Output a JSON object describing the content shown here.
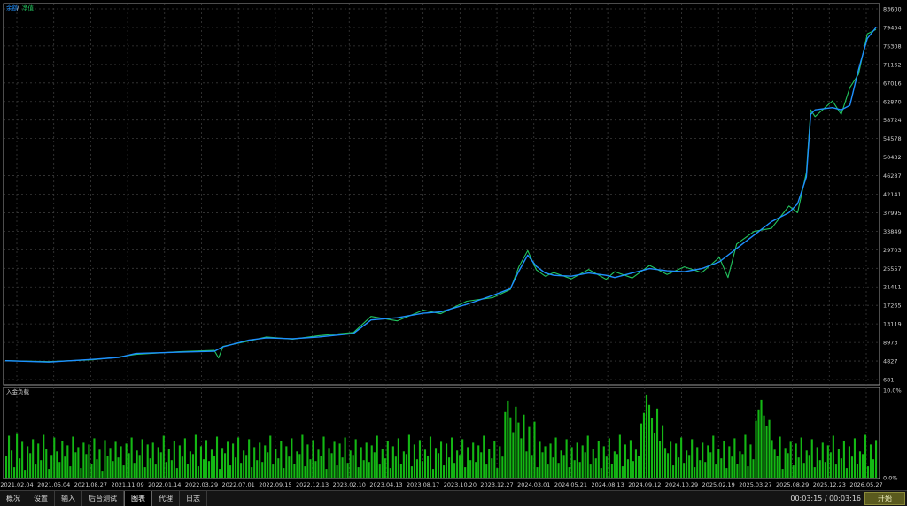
{
  "legend": {
    "balance_label": "余额",
    "separator": "/",
    "equity_label": "净值",
    "balance_color": "#1e90ff",
    "equity_color": "#22c55e"
  },
  "deposit_label": "入金负载",
  "tabs": [
    {
      "label": "概况",
      "active": false
    },
    {
      "label": "设置",
      "active": false
    },
    {
      "label": "输入",
      "active": false
    },
    {
      "label": "后台测试",
      "active": false
    },
    {
      "label": "图表",
      "active": true
    },
    {
      "label": "代理",
      "active": false
    },
    {
      "label": "日志",
      "active": false
    }
  ],
  "timer": "00:03:15 / 00:03:16",
  "start_label": "开始",
  "chart_data": [
    {
      "type": "line",
      "y_ticks": [
        "83600",
        "79454",
        "75308",
        "71162",
        "67016",
        "62870",
        "58724",
        "54578",
        "50432",
        "46287",
        "42141",
        "37995",
        "33849",
        "29703",
        "25557",
        "21411",
        "17265",
        "13119",
        "8973",
        "4827",
        "681"
      ],
      "ylim": [
        681,
        83600
      ],
      "x_ticks": [
        "2021.02.04",
        "2021.05.04",
        "2021.08.27",
        "2021.11.09",
        "2022.01.14",
        "2022.03.29",
        "2022.07.01",
        "2022.09.15",
        "2022.12.13",
        "2023.02.10",
        "2023.04.13",
        "2023.08.17",
        "2023.10.20",
        "2023.12.27",
        "2024.03.01",
        "2024.05.21",
        "2024.08.13",
        "2024.09.12",
        "2024.10.29",
        "2025.02.19",
        "2025.03.27",
        "2025.08.29",
        "2025.12.23",
        "2026.05.27"
      ],
      "grid": true,
      "series": [
        {
          "name": "余额",
          "color": "#1e90ff",
          "x": [
            0,
            0.05,
            0.1,
            0.13,
            0.15,
            0.2,
            0.24,
            0.25,
            0.28,
            0.3,
            0.33,
            0.36,
            0.4,
            0.42,
            0.45,
            0.48,
            0.5,
            0.53,
            0.56,
            0.58,
            0.59,
            0.6,
            0.61,
            0.62,
            0.63,
            0.65,
            0.67,
            0.69,
            0.7,
            0.72,
            0.74,
            0.76,
            0.78,
            0.8,
            0.82,
            0.84,
            0.86,
            0.88,
            0.9,
            0.91,
            0.92,
            0.925,
            0.93,
            0.95,
            0.96,
            0.97,
            0.98,
            0.99,
            1.0
          ],
          "values": [
            4900,
            4600,
            5200,
            5600,
            6500,
            6800,
            7000,
            8000,
            9500,
            10000,
            9800,
            10200,
            11000,
            14000,
            14500,
            15500,
            15800,
            17500,
            19500,
            21000,
            25000,
            28500,
            26000,
            24500,
            24000,
            23800,
            24500,
            24000,
            23500,
            24500,
            25500,
            25000,
            24800,
            25500,
            27000,
            30000,
            33000,
            36000,
            38000,
            40000,
            46000,
            60000,
            61000,
            61500,
            61000,
            62000,
            70000,
            77000,
            79454
          ]
        },
        {
          "name": "净值",
          "color": "#22c55e",
          "x": [
            0,
            0.05,
            0.1,
            0.13,
            0.15,
            0.2,
            0.24,
            0.245,
            0.25,
            0.28,
            0.3,
            0.33,
            0.36,
            0.4,
            0.42,
            0.45,
            0.48,
            0.5,
            0.53,
            0.56,
            0.58,
            0.59,
            0.6,
            0.61,
            0.62,
            0.63,
            0.65,
            0.67,
            0.69,
            0.7,
            0.72,
            0.74,
            0.76,
            0.78,
            0.8,
            0.82,
            0.83,
            0.84,
            0.86,
            0.88,
            0.9,
            0.91,
            0.92,
            0.925,
            0.93,
            0.95,
            0.96,
            0.97,
            0.98,
            0.99,
            1.0
          ],
          "values": [
            4900,
            4700,
            5100,
            5700,
            6300,
            6900,
            7200,
            5500,
            8100,
            9300,
            10200,
            9700,
            10500,
            11200,
            14800,
            13800,
            16200,
            15400,
            18200,
            19000,
            20800,
            26000,
            29500,
            25200,
            23800,
            24600,
            23200,
            25300,
            23100,
            24800,
            23400,
            26200,
            24200,
            25900,
            24600,
            28000,
            23500,
            31000,
            33800,
            34500,
            39500,
            38000,
            47000,
            61000,
            59500,
            63000,
            60000,
            66000,
            69000,
            78000,
            79000
          ]
        }
      ]
    },
    {
      "type": "bar",
      "title": "入金负载",
      "y_ticks": [
        "10.0%",
        "0.0%"
      ],
      "ylim": [
        0,
        10
      ],
      "grid": true,
      "values": [
        2.5,
        4.8,
        3.1,
        1.2,
        5.0,
        2.2,
        4.1,
        0.9,
        3.6,
        2.8,
        4.4,
        1.5,
        3.9,
        2.0,
        4.9,
        3.3,
        1.0,
        2.6,
        4.6,
        3.0,
        1.8,
        4.2,
        2.4,
        3.7,
        1.3,
        4.7,
        2.9,
        3.5,
        1.1,
        4.0,
        2.7,
        3.8,
        1.6,
        4.5,
        2.1,
        3.2,
        0.8,
        4.3,
        2.5,
        3.4,
        1.9,
        4.1,
        2.3,
        3.6,
        1.4,
        3.9,
        2.8,
        4.6,
        1.7,
        3.1,
        2.6,
        4.4,
        1.2,
        3.8,
        2.2,
        4.0,
        1.5,
        3.5,
        2.9,
        4.8,
        1.8,
        3.3,
        2.0,
        4.2,
        1.1,
        3.7,
        2.4,
        4.5,
        1.6,
        3.0,
        2.7,
        4.9,
        1.3,
        3.6,
        2.1,
        4.3,
        1.9,
        3.2,
        2.5,
        4.7,
        1.0,
        3.4,
        2.8,
        4.1,
        1.4,
        3.9,
        2.3,
        4.6,
        1.7,
        3.1,
        2.6,
        4.4,
        1.2,
        3.5,
        2.0,
        4.0,
        1.8,
        3.7,
        2.9,
        4.8,
        1.5,
        3.3,
        2.2,
        4.2,
        1.1,
        3.6,
        2.4,
        4.5,
        1.6,
        3.0,
        2.7,
        4.9,
        1.3,
        3.8,
        2.1,
        4.3,
        1.9,
        3.2,
        2.5,
        4.7,
        1.0,
        3.4,
        2.8,
        4.1,
        1.4,
        3.9,
        2.3,
        4.6,
        1.7,
        3.1,
        2.6,
        4.4,
        1.2,
        3.5,
        2.0,
        4.0,
        1.8,
        3.7,
        2.9,
        4.8,
        1.5,
        3.3,
        2.2,
        4.2,
        1.1,
        3.6,
        2.4,
        4.5,
        1.6,
        3.0,
        2.7,
        4.9,
        1.3,
        3.8,
        2.1,
        4.3,
        1.9,
        3.2,
        2.5,
        4.7,
        1.0,
        3.4,
        2.8,
        4.1,
        1.4,
        3.9,
        2.3,
        4.6,
        1.7,
        3.1,
        2.6,
        4.4,
        1.2,
        3.5,
        2.0,
        4.0,
        1.8,
        3.7,
        2.9,
        4.8,
        1.5,
        3.3,
        2.2,
        4.2,
        1.1,
        3.6,
        2.4,
        7.5,
        8.8,
        6.9,
        5.2,
        8.1,
        6.3,
        4.5,
        7.2,
        3.0,
        5.8,
        2.6,
        6.4,
        1.2,
        4.1,
        2.9,
        3.6,
        1.5,
        3.9,
        2.3,
        4.6,
        1.7,
        3.1,
        2.6,
        4.4,
        1.2,
        3.5,
        2.0,
        4.0,
        1.8,
        3.7,
        2.9,
        4.8,
        1.5,
        3.3,
        2.2,
        4.2,
        1.1,
        3.6,
        2.4,
        4.5,
        1.6,
        3.0,
        2.7,
        4.9,
        1.3,
        3.8,
        2.1,
        4.3,
        1.9,
        3.2,
        2.5,
        6.2,
        7.4,
        9.5,
        8.3,
        6.8,
        5.1,
        7.9,
        4.2,
        6.0,
        3.4,
        2.8,
        4.1,
        1.4,
        3.9,
        2.3,
        4.6,
        1.7,
        3.1,
        2.6,
        4.4,
        1.2,
        3.5,
        2.0,
        4.0,
        1.8,
        3.7,
        2.9,
        4.8,
        1.5,
        3.3,
        2.2,
        4.2,
        1.1,
        3.6,
        2.4,
        4.5,
        1.6,
        3.0,
        2.7,
        4.9,
        1.3,
        3.8,
        2.1,
        6.5,
        7.8,
        8.9,
        7.1,
        5.9,
        6.6,
        4.3,
        3.2,
        2.5,
        4.7,
        1.0,
        3.4,
        2.8,
        4.1,
        1.4,
        3.9,
        2.3,
        4.6,
        1.7,
        3.1,
        2.6,
        4.4,
        1.2,
        3.5,
        2.0,
        4.0,
        1.8,
        3.7,
        2.9,
        4.8,
        1.5,
        3.3,
        2.2,
        4.2,
        1.1,
        3.6,
        2.4,
        4.5,
        1.6,
        3.0,
        2.7,
        4.9,
        1.3,
        3.8,
        2.1,
        4.3
      ]
    }
  ]
}
